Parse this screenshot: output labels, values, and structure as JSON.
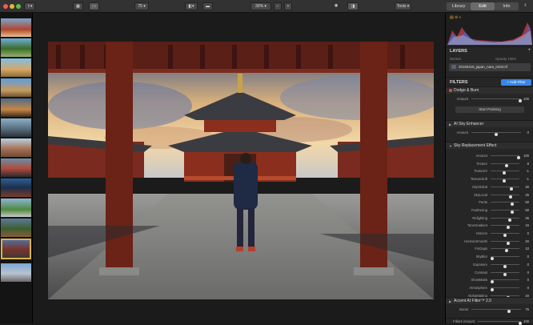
{
  "toolbar": {
    "zoom_label": "75",
    "zoom_percent": "30%",
    "minus_label": "−",
    "plus_label": "+",
    "tools_label": "Tools",
    "tabs": [
      "Library",
      "Edit",
      "Info"
    ]
  },
  "layers": {
    "title": "LAYERS",
    "opacity_label": "Opacity 100%",
    "normal_label": "Normal",
    "file_name": "20160416_japan_nara_0433.tif"
  },
  "filters": {
    "title": "FILTERS",
    "add_label": "+ Add Filter",
    "dodge_title": "Dodge & Burn",
    "dodge_amount_label": "Amount",
    "dodge_amount_value": "100",
    "start_painting": "Start Painting",
    "ai_sky_title": "AI Sky Enhancer",
    "ai_sky_amount_label": "Amount",
    "ai_sky_amount_value": "0",
    "sky_replacement_title": "Sky Replacement Effect",
    "sliders": [
      {
        "label": "Amount",
        "value": "100",
        "pos": 0.98
      },
      {
        "label": "Texture",
        "value": "8",
        "pos": 0.55
      },
      {
        "label": "TextureX",
        "value": "-1",
        "pos": 0.48
      },
      {
        "label": "TextureSoft",
        "value": "-1",
        "pos": 0.48
      },
      {
        "label": "SkyGlobal",
        "value": "30",
        "pos": 0.72
      },
      {
        "label": "SkyLocal",
        "value": "25",
        "pos": 0.7
      },
      {
        "label": "Pants",
        "value": "50",
        "pos": 0.75
      },
      {
        "label": "Feathering",
        "value": "50",
        "pos": 0.75
      },
      {
        "label": "Relighting",
        "value": "35",
        "pos": 0.67
      },
      {
        "label": "ToneGradient",
        "value": "15",
        "pos": 0.6
      },
      {
        "label": "Horizon",
        "value": "0",
        "pos": 0.5
      },
      {
        "label": "HorizonSmooth",
        "value": "20",
        "pos": 0.62
      },
      {
        "label": "FixGaps",
        "value": "10",
        "pos": 0.55
      },
      {
        "label": "SkyBlur",
        "value": "0",
        "pos": 0.05
      },
      {
        "label": "Exposure",
        "value": "0",
        "pos": 0.5
      },
      {
        "label": "Contrast",
        "value": "0",
        "pos": 0.5
      },
      {
        "label": "ShowMask",
        "value": "0",
        "pos": 0.05
      },
      {
        "label": "Atmosphere",
        "value": "0",
        "pos": 0.05
      },
      {
        "label": "AlphaMatting",
        "value": "20",
        "pos": 0.6
      }
    ],
    "accent_title": "Accent AI Filter™ 2.0",
    "accent_boost_label": "Boost",
    "accent_boost_value": "75",
    "filters_amount_label": "Filters Amount",
    "filters_amount_value": "100"
  },
  "colors": {
    "accent": "#3a86e8",
    "active_tab": "#5a5a5a"
  }
}
